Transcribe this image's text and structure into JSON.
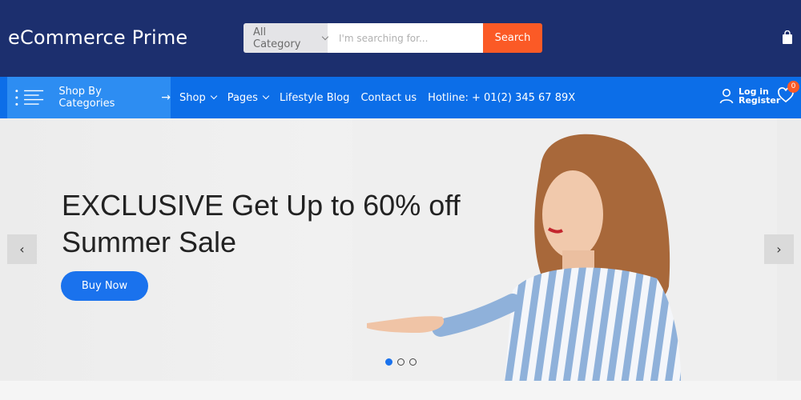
{
  "header": {
    "logo": "eCommerce Prime",
    "search": {
      "category": "All Category",
      "placeholder": "I'm searching for...",
      "button_label": "Search"
    },
    "cart_icon": "shopping-bag-icon"
  },
  "nav": {
    "shop_by_categories": "Shop By Categories",
    "links": [
      {
        "label": "Shop",
        "has_dropdown": true
      },
      {
        "label": "Pages",
        "has_dropdown": true
      },
      {
        "label": "Lifestyle Blog",
        "has_dropdown": false
      },
      {
        "label": "Contact us",
        "has_dropdown": false
      }
    ],
    "hotline": "Hotline: + 01(2) 345 67 89X",
    "login_label": "Log in",
    "register_label": "Register",
    "wishlist_count": "0"
  },
  "hero": {
    "title_line1": "EXCLUSIVE Get Up to 60% off",
    "title_line2": "Summer Sale",
    "button_label": "Buy Now",
    "prev_label": "‹",
    "next_label": "›",
    "slides_total": 3,
    "active_slide": 1
  },
  "colors": {
    "header_bg": "#1c2f6e",
    "nav_bg": "#0c6ee8",
    "accent_orange": "#fb5a26",
    "primary_blue": "#1a72ed"
  }
}
